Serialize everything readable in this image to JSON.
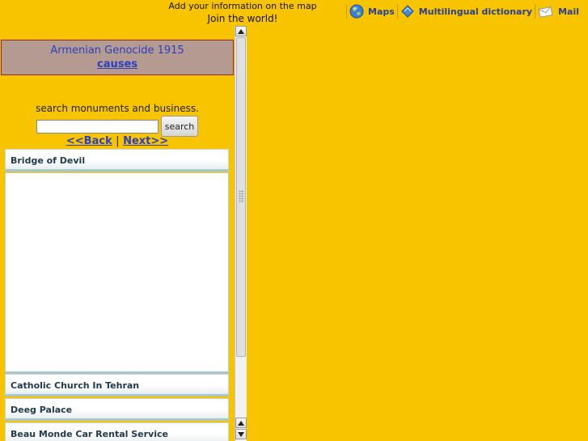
{
  "header": {
    "line1": "Add your information on the map",
    "line2": "Join the world!"
  },
  "nav": [
    {
      "label": "Maps",
      "icon": "globe-icon"
    },
    {
      "label": "Multilingual dictionary",
      "icon": "book-icon"
    },
    {
      "label": "Mail",
      "icon": "envelope-icon"
    }
  ],
  "banner": {
    "title": "Armenian Genocide 1915",
    "link": "causes"
  },
  "search": {
    "label": "search monuments and business.",
    "value": "",
    "placeholder": "",
    "button": "search"
  },
  "pager": {
    "back": "<<Back",
    "separator": "|",
    "next": "Next>>"
  },
  "list": {
    "items": [
      {
        "label": "Bridge of Devil",
        "expanded": true
      },
      {
        "label": "Catholic Church In Tehran"
      },
      {
        "label": "Deeg Palace"
      },
      {
        "label": "Beau Monde Car Rental Service"
      }
    ]
  },
  "colors": {
    "background": "#f8c400",
    "link": "#2b3fbf",
    "banner_bg": "#b59a92",
    "banner_border": "#9c2020"
  }
}
